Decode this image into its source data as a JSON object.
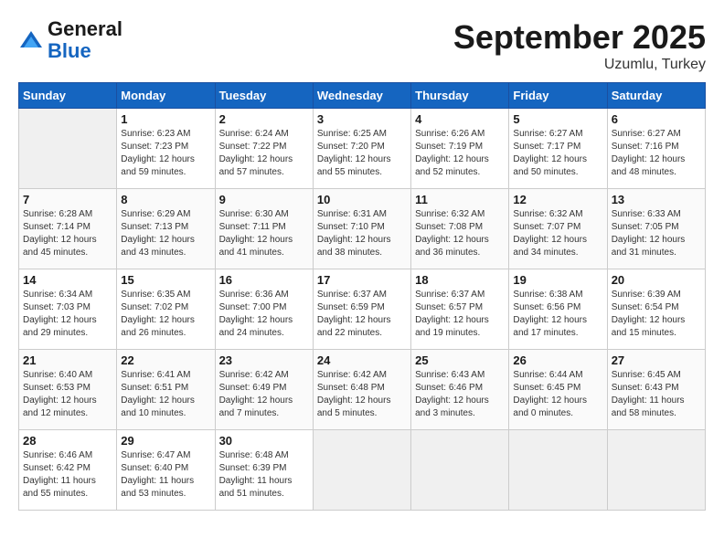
{
  "header": {
    "logo_line1": "General",
    "logo_line2": "Blue",
    "month": "September 2025",
    "location": "Uzumlu, Turkey"
  },
  "weekdays": [
    "Sunday",
    "Monday",
    "Tuesday",
    "Wednesday",
    "Thursday",
    "Friday",
    "Saturday"
  ],
  "weeks": [
    [
      {
        "day": "",
        "empty": true
      },
      {
        "day": "1",
        "sunrise": "Sunrise: 6:23 AM",
        "sunset": "Sunset: 7:23 PM",
        "daylight": "Daylight: 12 hours and 59 minutes."
      },
      {
        "day": "2",
        "sunrise": "Sunrise: 6:24 AM",
        "sunset": "Sunset: 7:22 PM",
        "daylight": "Daylight: 12 hours and 57 minutes."
      },
      {
        "day": "3",
        "sunrise": "Sunrise: 6:25 AM",
        "sunset": "Sunset: 7:20 PM",
        "daylight": "Daylight: 12 hours and 55 minutes."
      },
      {
        "day": "4",
        "sunrise": "Sunrise: 6:26 AM",
        "sunset": "Sunset: 7:19 PM",
        "daylight": "Daylight: 12 hours and 52 minutes."
      },
      {
        "day": "5",
        "sunrise": "Sunrise: 6:27 AM",
        "sunset": "Sunset: 7:17 PM",
        "daylight": "Daylight: 12 hours and 50 minutes."
      },
      {
        "day": "6",
        "sunrise": "Sunrise: 6:27 AM",
        "sunset": "Sunset: 7:16 PM",
        "daylight": "Daylight: 12 hours and 48 minutes."
      }
    ],
    [
      {
        "day": "7",
        "sunrise": "Sunrise: 6:28 AM",
        "sunset": "Sunset: 7:14 PM",
        "daylight": "Daylight: 12 hours and 45 minutes."
      },
      {
        "day": "8",
        "sunrise": "Sunrise: 6:29 AM",
        "sunset": "Sunset: 7:13 PM",
        "daylight": "Daylight: 12 hours and 43 minutes."
      },
      {
        "day": "9",
        "sunrise": "Sunrise: 6:30 AM",
        "sunset": "Sunset: 7:11 PM",
        "daylight": "Daylight: 12 hours and 41 minutes."
      },
      {
        "day": "10",
        "sunrise": "Sunrise: 6:31 AM",
        "sunset": "Sunset: 7:10 PM",
        "daylight": "Daylight: 12 hours and 38 minutes."
      },
      {
        "day": "11",
        "sunrise": "Sunrise: 6:32 AM",
        "sunset": "Sunset: 7:08 PM",
        "daylight": "Daylight: 12 hours and 36 minutes."
      },
      {
        "day": "12",
        "sunrise": "Sunrise: 6:32 AM",
        "sunset": "Sunset: 7:07 PM",
        "daylight": "Daylight: 12 hours and 34 minutes."
      },
      {
        "day": "13",
        "sunrise": "Sunrise: 6:33 AM",
        "sunset": "Sunset: 7:05 PM",
        "daylight": "Daylight: 12 hours and 31 minutes."
      }
    ],
    [
      {
        "day": "14",
        "sunrise": "Sunrise: 6:34 AM",
        "sunset": "Sunset: 7:03 PM",
        "daylight": "Daylight: 12 hours and 29 minutes."
      },
      {
        "day": "15",
        "sunrise": "Sunrise: 6:35 AM",
        "sunset": "Sunset: 7:02 PM",
        "daylight": "Daylight: 12 hours and 26 minutes."
      },
      {
        "day": "16",
        "sunrise": "Sunrise: 6:36 AM",
        "sunset": "Sunset: 7:00 PM",
        "daylight": "Daylight: 12 hours and 24 minutes."
      },
      {
        "day": "17",
        "sunrise": "Sunrise: 6:37 AM",
        "sunset": "Sunset: 6:59 PM",
        "daylight": "Daylight: 12 hours and 22 minutes."
      },
      {
        "day": "18",
        "sunrise": "Sunrise: 6:37 AM",
        "sunset": "Sunset: 6:57 PM",
        "daylight": "Daylight: 12 hours and 19 minutes."
      },
      {
        "day": "19",
        "sunrise": "Sunrise: 6:38 AM",
        "sunset": "Sunset: 6:56 PM",
        "daylight": "Daylight: 12 hours and 17 minutes."
      },
      {
        "day": "20",
        "sunrise": "Sunrise: 6:39 AM",
        "sunset": "Sunset: 6:54 PM",
        "daylight": "Daylight: 12 hours and 15 minutes."
      }
    ],
    [
      {
        "day": "21",
        "sunrise": "Sunrise: 6:40 AM",
        "sunset": "Sunset: 6:53 PM",
        "daylight": "Daylight: 12 hours and 12 minutes."
      },
      {
        "day": "22",
        "sunrise": "Sunrise: 6:41 AM",
        "sunset": "Sunset: 6:51 PM",
        "daylight": "Daylight: 12 hours and 10 minutes."
      },
      {
        "day": "23",
        "sunrise": "Sunrise: 6:42 AM",
        "sunset": "Sunset: 6:49 PM",
        "daylight": "Daylight: 12 hours and 7 minutes."
      },
      {
        "day": "24",
        "sunrise": "Sunrise: 6:42 AM",
        "sunset": "Sunset: 6:48 PM",
        "daylight": "Daylight: 12 hours and 5 minutes."
      },
      {
        "day": "25",
        "sunrise": "Sunrise: 6:43 AM",
        "sunset": "Sunset: 6:46 PM",
        "daylight": "Daylight: 12 hours and 3 minutes."
      },
      {
        "day": "26",
        "sunrise": "Sunrise: 6:44 AM",
        "sunset": "Sunset: 6:45 PM",
        "daylight": "Daylight: 12 hours and 0 minutes."
      },
      {
        "day": "27",
        "sunrise": "Sunrise: 6:45 AM",
        "sunset": "Sunset: 6:43 PM",
        "daylight": "Daylight: 11 hours and 58 minutes."
      }
    ],
    [
      {
        "day": "28",
        "sunrise": "Sunrise: 6:46 AM",
        "sunset": "Sunset: 6:42 PM",
        "daylight": "Daylight: 11 hours and 55 minutes."
      },
      {
        "day": "29",
        "sunrise": "Sunrise: 6:47 AM",
        "sunset": "Sunset: 6:40 PM",
        "daylight": "Daylight: 11 hours and 53 minutes."
      },
      {
        "day": "30",
        "sunrise": "Sunrise: 6:48 AM",
        "sunset": "Sunset: 6:39 PM",
        "daylight": "Daylight: 11 hours and 51 minutes."
      },
      {
        "day": "",
        "empty": true
      },
      {
        "day": "",
        "empty": true
      },
      {
        "day": "",
        "empty": true
      },
      {
        "day": "",
        "empty": true
      }
    ]
  ]
}
